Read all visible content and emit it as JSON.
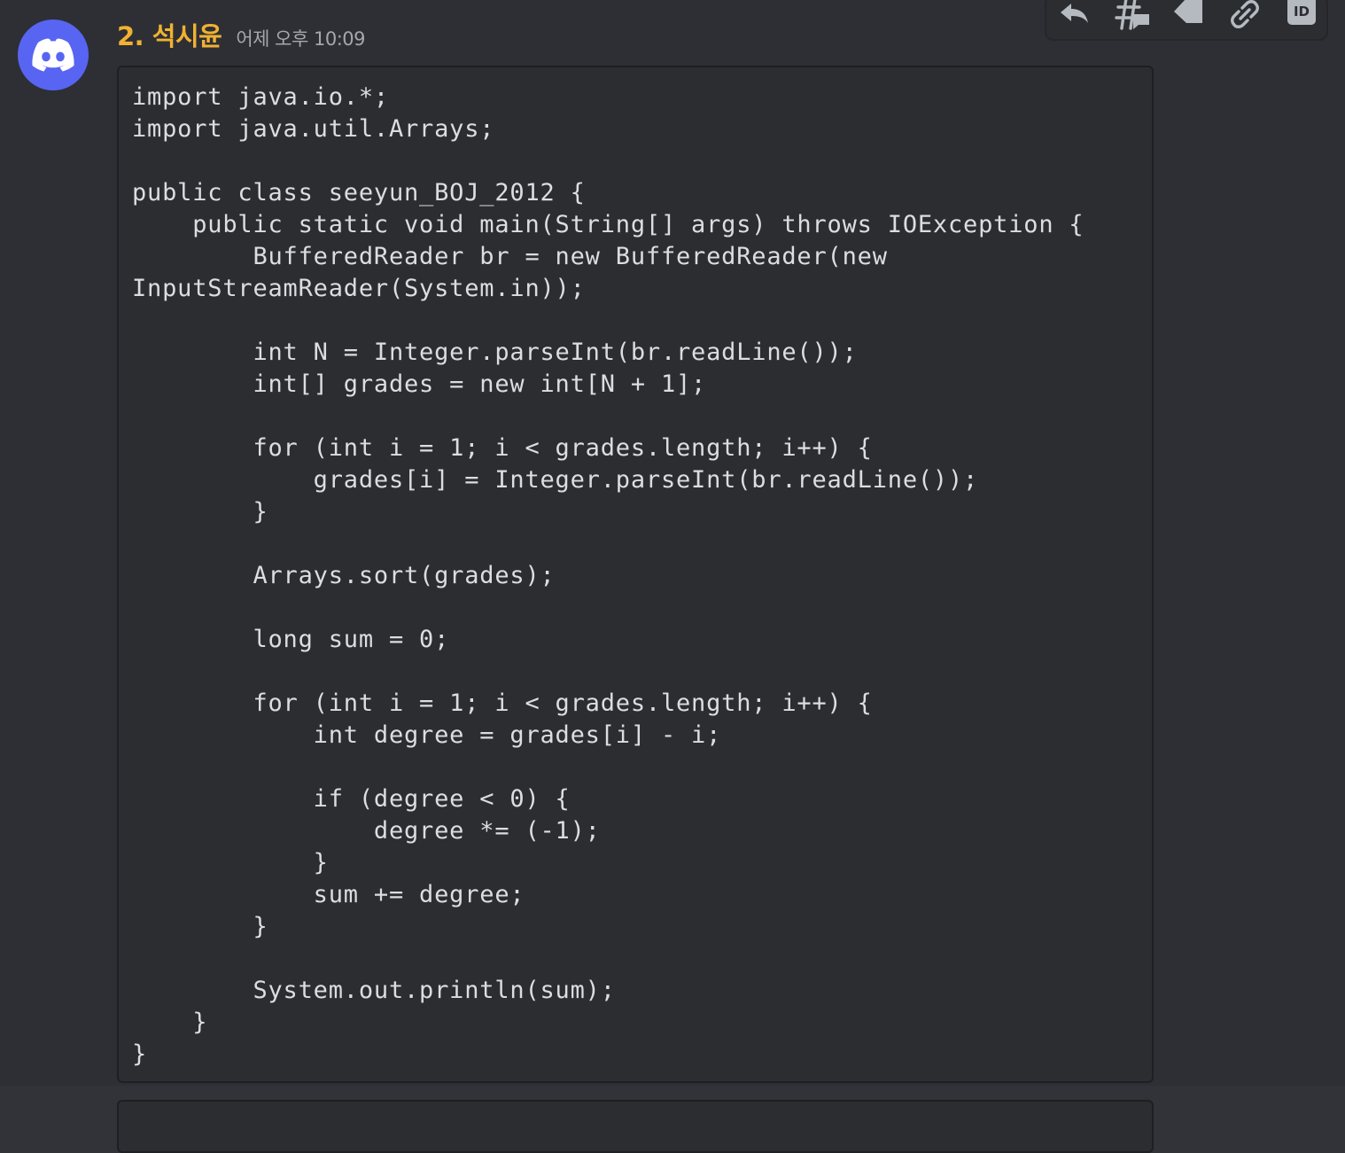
{
  "message": {
    "author": "2. 석시윤",
    "timestamp": "어제 오후 10:09",
    "avatar_icon": "discord-logo-icon",
    "code": "import java.io.*;\nimport java.util.Arrays;\n\npublic class seeyun_BOJ_2012 {\n    public static void main(String[] args) throws IOException {\n        BufferedReader br = new BufferedReader(new\nInputStreamReader(System.in));\n\n        int N = Integer.parseInt(br.readLine());\n        int[] grades = new int[N + 1];\n\n        for (int i = 1; i < grades.length; i++) {\n            grades[i] = Integer.parseInt(br.readLine());\n        }\n\n        Arrays.sort(grades);\n\n        long sum = 0;\n\n        for (int i = 1; i < grades.length; i++) {\n            int degree = grades[i] - i;\n\n            if (degree < 0) {\n                degree *= (-1);\n            }\n            sum += degree;\n        }\n\n        System.out.println(sum);\n    }\n}"
  },
  "toolbar": {
    "icons": [
      "reply-icon",
      "create-thread-icon",
      "tag-icon",
      "copy-link-icon",
      "copy-id-icon"
    ],
    "id_glyph": "ID"
  },
  "colors": {
    "background": "#313338",
    "username": "#f0b232",
    "avatar": "#5865f2",
    "code_background": "#2b2d31",
    "code_text": "#dbdee1"
  }
}
